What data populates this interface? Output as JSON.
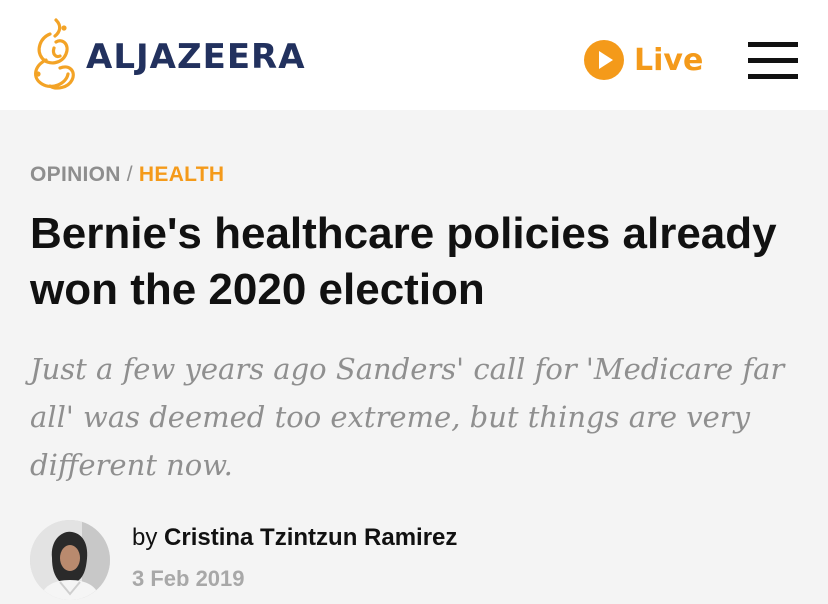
{
  "brand": {
    "name": "ALJAZEERA",
    "accent": "#f49a1a",
    "navy": "#22315e"
  },
  "header": {
    "live_label": "Live",
    "live_icon": "play-circle-icon",
    "menu_icon": "hamburger-menu-icon"
  },
  "breadcrumb": {
    "section": "OPINION",
    "separator": "/",
    "category": "HEALTH"
  },
  "article": {
    "title": "Bernie's healthcare policies already won the 2020 election",
    "subtitle": "Just a few years ago Sanders' call for 'Medicare far all' was deemed too extreme, but things are very different now.",
    "byline_prefix": "by",
    "author": "Cristina Tzintzun Ramirez",
    "date": "3 Feb 2019"
  }
}
